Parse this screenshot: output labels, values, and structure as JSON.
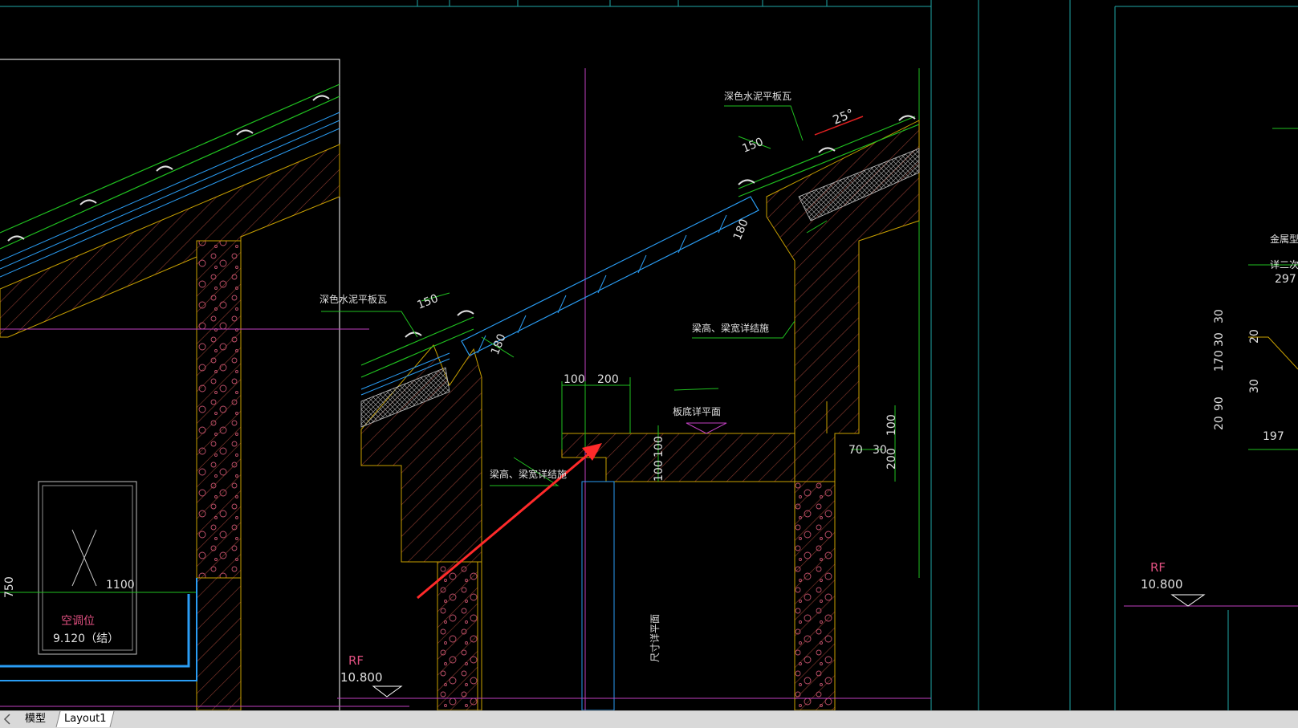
{
  "tabs": [
    {
      "label": "模型",
      "active": true
    },
    {
      "label": "Layout1",
      "active": false
    }
  ],
  "drawing": {
    "background": "#000000",
    "annotations": {
      "tile_left": "深色水泥平板瓦",
      "tile_right": "深色水泥平板瓦",
      "beam_note_right": "梁高、梁宽详结施",
      "beam_note_left": "梁高、梁宽详结施",
      "slab_level": "板底详平面",
      "size_plan": "尺寸详平面",
      "ac_label": "空调位",
      "ac_level": "9.120（结）",
      "rf_left": "RF",
      "rf_left_level": "10.800",
      "rf_right": "RF",
      "rf_right_level": "10.800",
      "metal_note": "金属型材",
      "detail_note": "详二次设",
      "angle": "25°"
    },
    "dimensions": {
      "d150_left": "150",
      "d180_left": "180",
      "d150_right": "150",
      "d180_right": "180",
      "d100_top": "100",
      "d200_top": "200",
      "d100_v1": "100",
      "d100_v2": "100",
      "d100_r": "100",
      "d200_r": "200",
      "d70": "70",
      "d30": "30",
      "d1100": "1100",
      "d750": "750",
      "d297": "297",
      "d197": "197",
      "d30a": "30",
      "d30b": "30",
      "d170": "170",
      "d20a": "20",
      "d30c": "30",
      "d90": "90",
      "d20b": "20"
    }
  }
}
